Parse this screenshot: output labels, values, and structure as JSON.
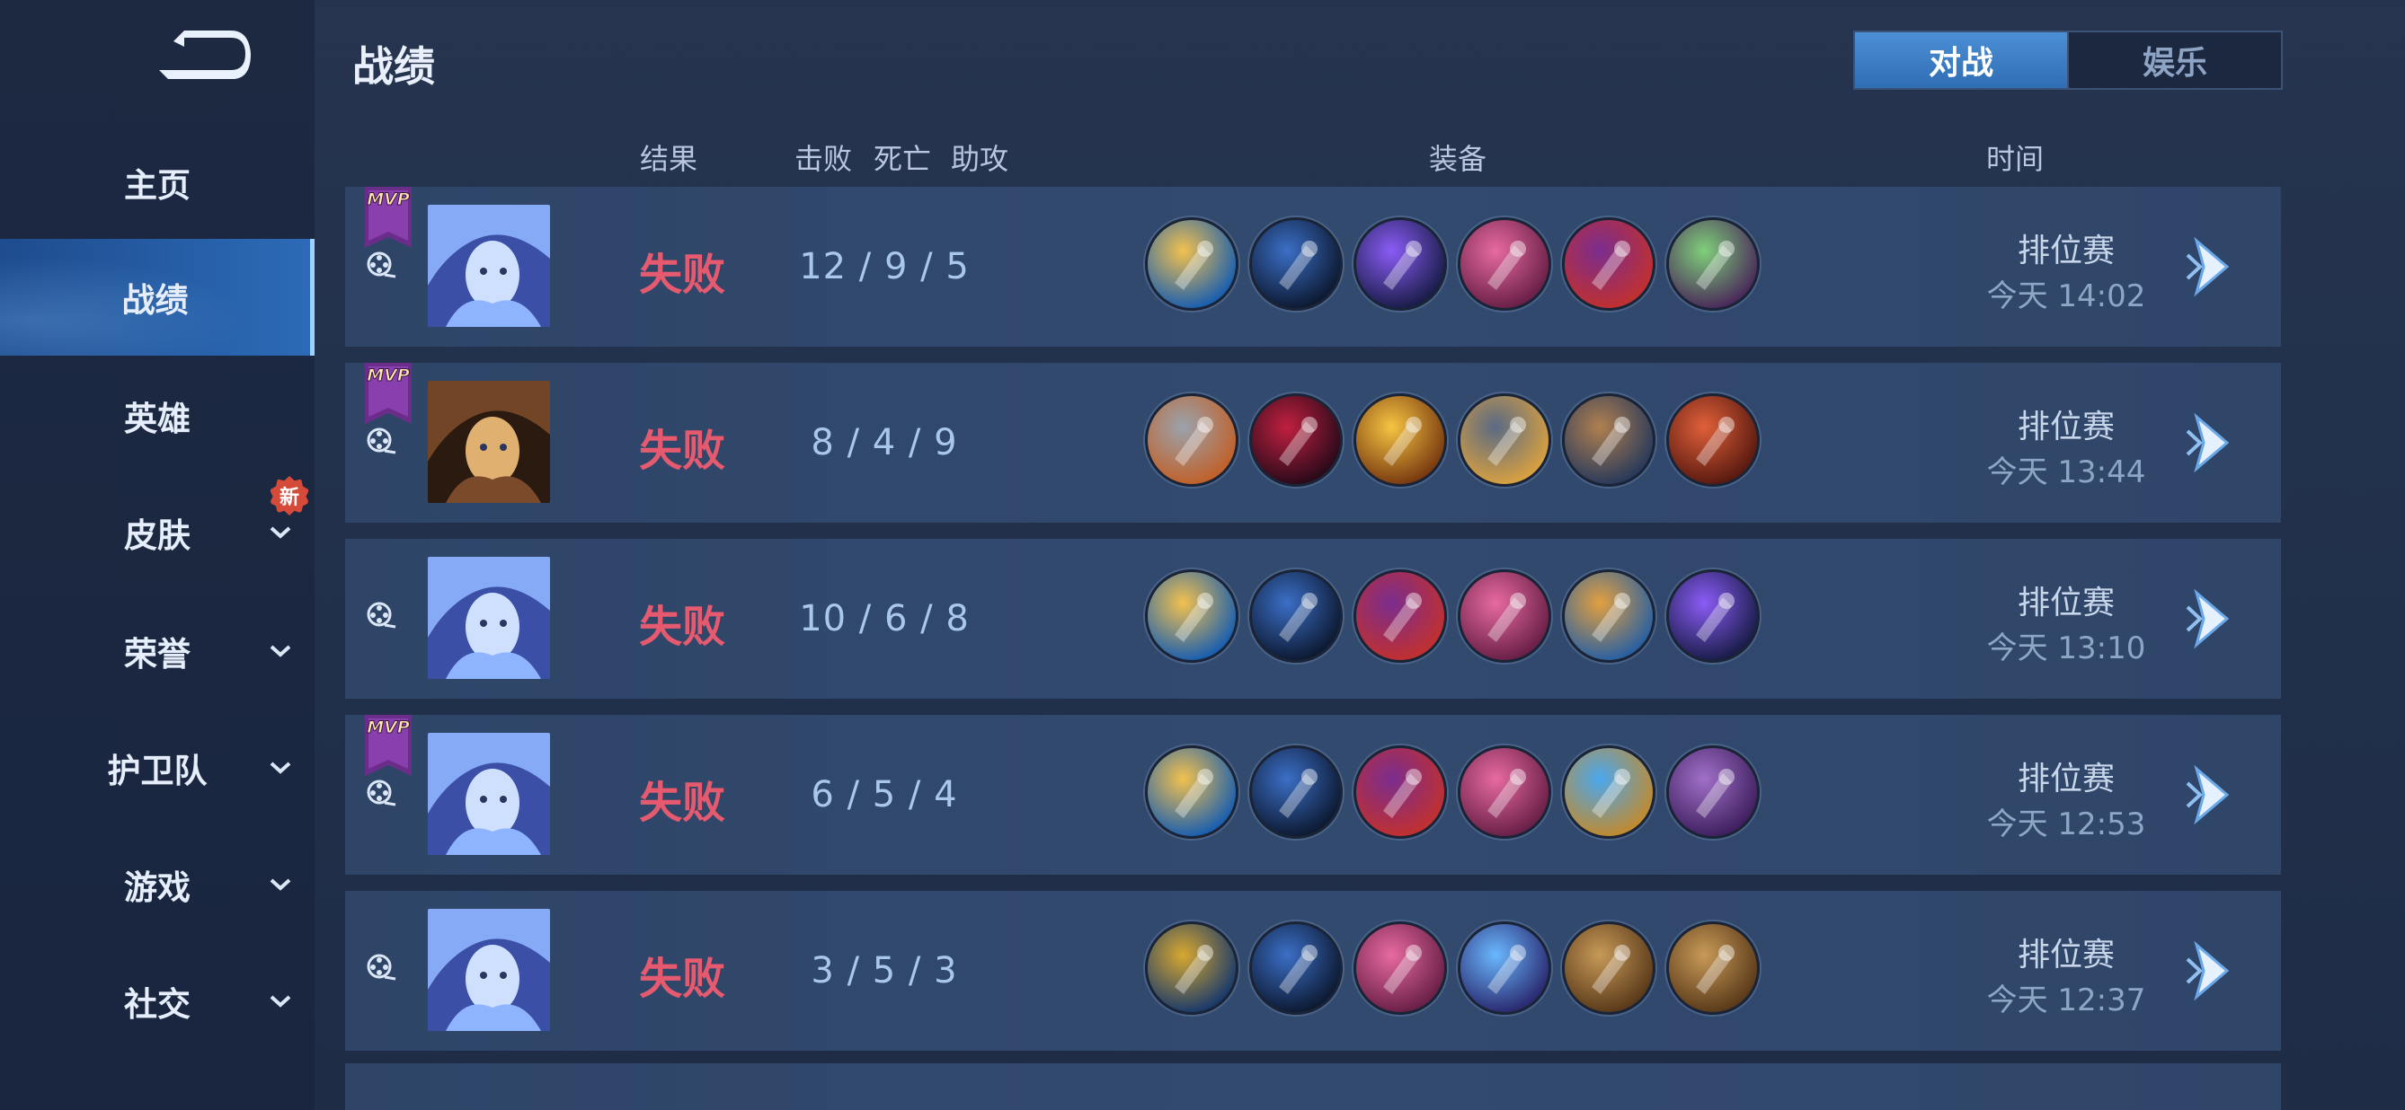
{
  "sidebar": {
    "back_label": "",
    "items": [
      {
        "label": "主页"
      },
      {
        "label": "战绩"
      },
      {
        "label": "英雄"
      },
      {
        "label": "皮肤"
      },
      {
        "label": "荣誉"
      },
      {
        "label": "护卫队"
      },
      {
        "label": "游戏"
      },
      {
        "label": "社交"
      }
    ],
    "new_badge": "新"
  },
  "header": {
    "title": "战绩",
    "tabs": [
      {
        "label": "对战",
        "selected": true
      },
      {
        "label": "娱乐",
        "selected": false
      }
    ]
  },
  "columns": {
    "result": "结果",
    "kills": "击败",
    "deaths": "死亡",
    "assists": "助攻",
    "equipment": "装备",
    "time": "时间"
  },
  "mvp_text": "MVP",
  "matches": [
    {
      "mvp": true,
      "hero_icon": "blue-haired-hero",
      "result": "失败",
      "kda": "12 / 9 / 5",
      "mode": "排位赛",
      "time": "今天 14:02",
      "items": [
        "gold-staff-icon",
        "blue-boots-icon",
        "purple-wand-icon",
        "pink-spellbook-icon",
        "witch-hat-icon",
        "green-tome-icon"
      ]
    },
    {
      "mvp": true,
      "hero_icon": "hat-goggles-hero",
      "result": "失败",
      "kda": "8 / 4 / 9",
      "mode": "排位赛",
      "time": "今天 13:44",
      "items": [
        "armored-boots-icon",
        "red-blade-icon",
        "gold-sword-icon",
        "dark-armor-icon",
        "gauntlet-icon",
        "red-spear-icon"
      ]
    },
    {
      "mvp": false,
      "hero_icon": "blue-haired-hero",
      "result": "失败",
      "kda": "10 / 6 / 8",
      "mode": "排位赛",
      "time": "今天 13:10",
      "items": [
        "gold-staff-icon",
        "blue-boots-icon",
        "witch-hat-icon",
        "pink-spellbook-icon",
        "gem-scepter-icon",
        "purple-wand-icon"
      ]
    },
    {
      "mvp": true,
      "hero_icon": "blue-haired-hero",
      "result": "失败",
      "kda": "6 / 5 / 4",
      "mode": "排位赛",
      "time": "今天 12:53",
      "items": [
        "gold-staff-icon",
        "blue-boots-icon",
        "witch-hat-icon",
        "pink-spellbook-icon",
        "orb-staff-icon",
        "purple-tome-icon"
      ]
    },
    {
      "mvp": false,
      "hero_icon": "blue-haired-hero",
      "result": "失败",
      "kda": "3 / 5 / 3",
      "mode": "排位赛",
      "time": "今天 12:37",
      "items": [
        "gold-scroll-icon",
        "blue-boots-icon",
        "pink-spellbook-icon",
        "blue-crystal-icon",
        "wooden-shield-icon",
        "wooden-shield-icon"
      ]
    }
  ],
  "colors": {
    "defeat": "#e65a6f",
    "accent": "#3f82cf",
    "row": "#2f4669"
  }
}
